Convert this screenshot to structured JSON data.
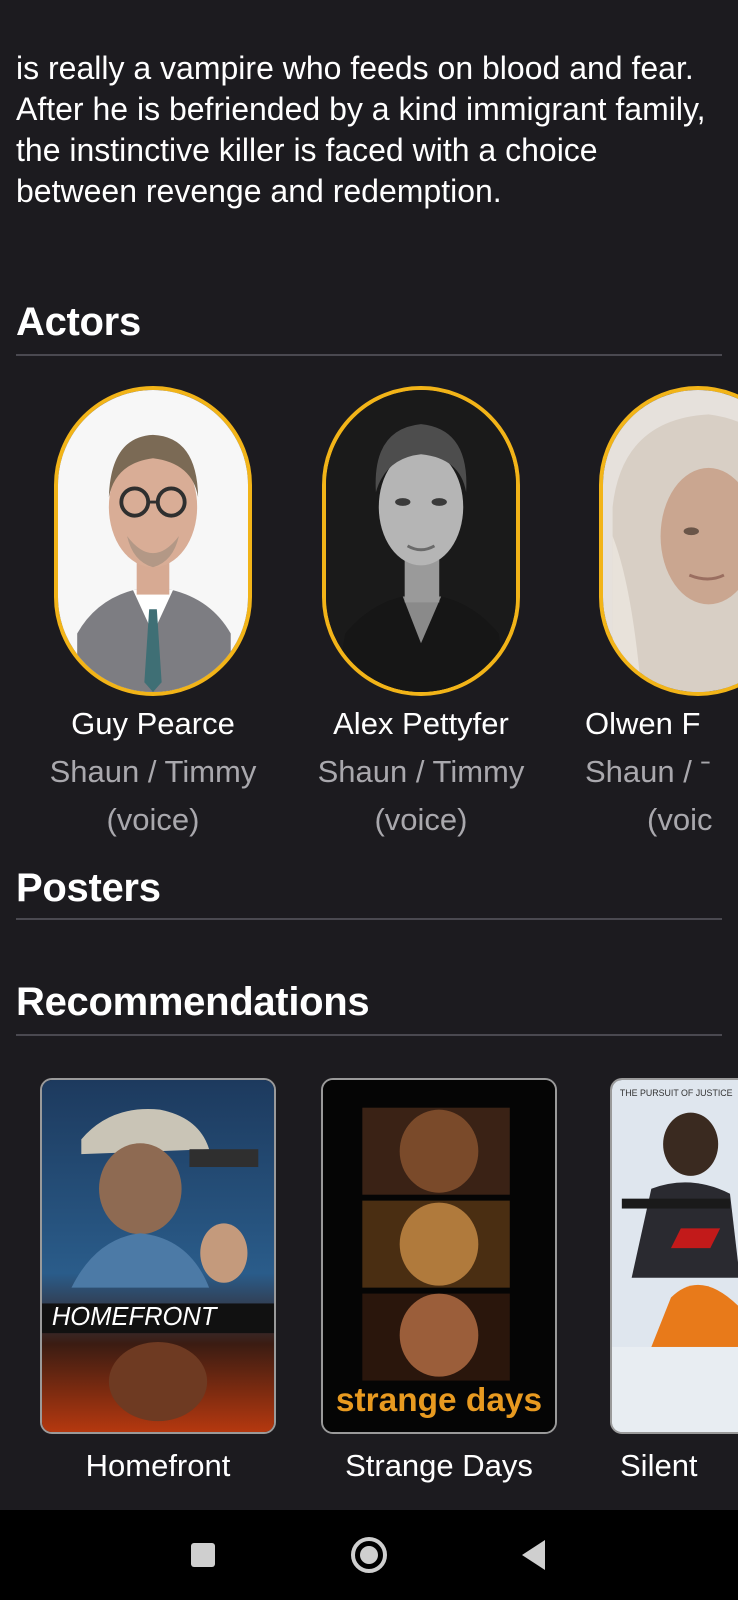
{
  "synopsis": "is really a vampire who feeds on blood and fear. After he is befriended by a kind immigrant family, the instinctive killer is faced with a choice between revenge and redemption.",
  "sections": {
    "actors": "Actors",
    "posters": "Posters",
    "recommendations": "Recommendations"
  },
  "actors": [
    {
      "name": "Guy Pearce",
      "role": "Shaun / Timmy",
      "role2": "(voice)"
    },
    {
      "name": "Alex Pettyfer",
      "role": "Shaun / Timmy",
      "role2": "(voice)"
    },
    {
      "name": "Olwen F",
      "role": "Shaun / ˉ",
      "role2": "(voic"
    }
  ],
  "recommendations": [
    {
      "title": "Homefront",
      "poster_text": "HOMEFRONT"
    },
    {
      "title": "Strange Days",
      "poster_text": "strange days"
    },
    {
      "title": "Silent",
      "poster_text": "THE PURSUIT OF JUSTICE"
    }
  ],
  "colors": {
    "background": "#1c1b1f",
    "accent_ring": "#f2b418",
    "secondary_text": "#a9a8ad",
    "divider": "#4a4950"
  },
  "nav": {
    "recents_icon": "square-icon",
    "home_icon": "circle-icon",
    "back_icon": "triangle-back-icon"
  }
}
